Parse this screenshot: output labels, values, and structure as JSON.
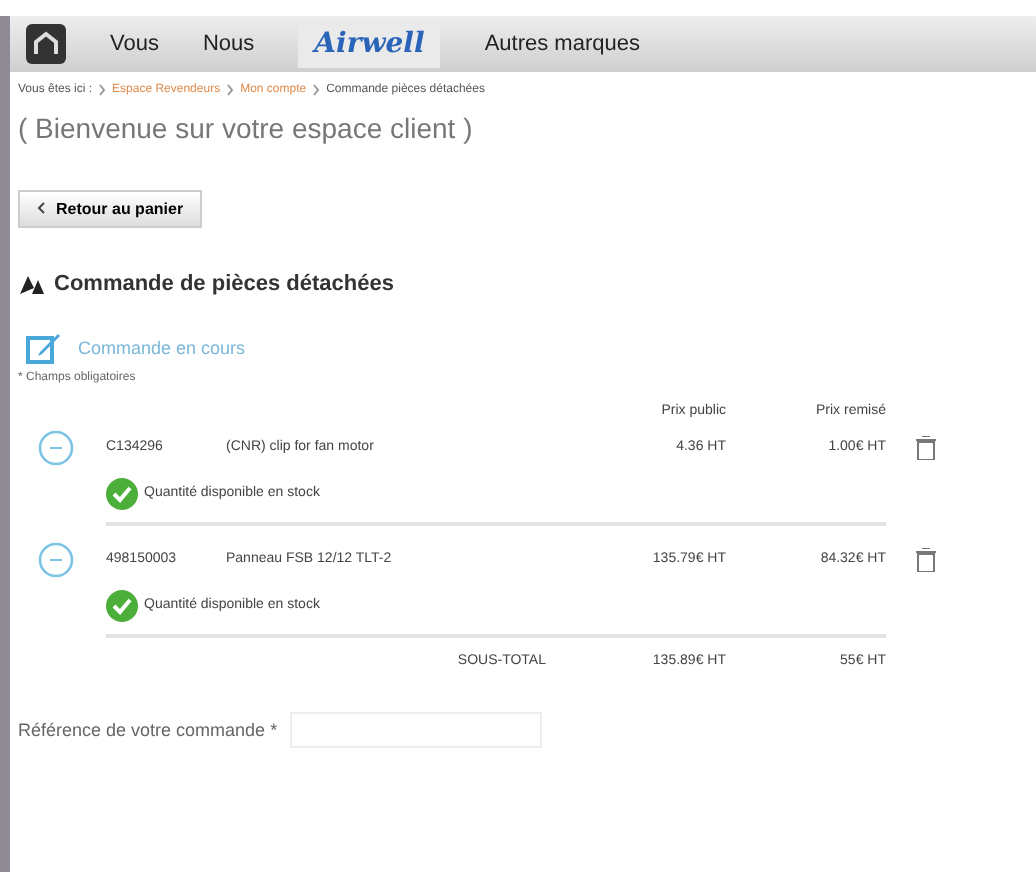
{
  "nav": {
    "items": [
      {
        "label": "Vous",
        "kind": "text"
      },
      {
        "label": "Nous",
        "kind": "text"
      },
      {
        "label": "Airwell",
        "kind": "logo"
      },
      {
        "label": "Autres marques",
        "kind": "text"
      }
    ]
  },
  "breadcrumb": {
    "prefix": "Vous êtes ici :",
    "links": [
      "Espace Revendeurs",
      "Mon compte"
    ],
    "current": "Commande pièces détachées"
  },
  "welcome": "( Bienvenue sur votre espace client )",
  "back_button": "Retour au panier",
  "section_title": "Commande de pièces détachées",
  "subsection_title": "Commande en cours",
  "required_note": "* Champs obligatoires",
  "table": {
    "columns": [
      "Prix public",
      "Prix remisé"
    ],
    "rows": [
      {
        "ref": "C134296",
        "name": "(CNR) clip for fan motor",
        "public": "4.36 HT",
        "discounted": "1.00€ HT",
        "stock": "Quantité disponible en stock"
      },
      {
        "ref": "498150003",
        "name": "Panneau FSB 12/12 TLT-2",
        "public": "135.79€ HT",
        "discounted": "84.32€ HT",
        "stock": "Quantité disponible en stock"
      }
    ],
    "subtotal": {
      "label": "SOUS-TOTAL",
      "public": "135.89€ HT",
      "discounted": "55€ HT"
    }
  },
  "reference_field": {
    "label": "Référence de votre commande *"
  }
}
